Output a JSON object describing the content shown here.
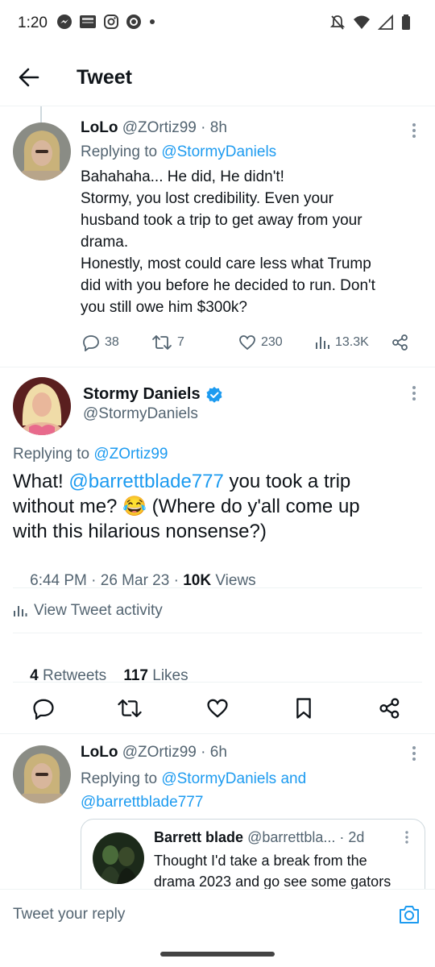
{
  "status_bar": {
    "time": "1:20"
  },
  "header": {
    "title": "Tweet"
  },
  "tweet1": {
    "name": "LoLo",
    "handle": "@ZOrtiz99",
    "time": "· 8h",
    "replying_prefix": "Replying to",
    "replying_to": "@StormyDaniels",
    "lines": [
      "Bahahaha... He did, He didn't!",
      "Stormy, you lost credibility. Even your",
      "husband took a trip to get away from your",
      "drama.",
      "Honestly, most could care less what Trump",
      "did with you before he decided to run. Don't",
      "you still owe him $300k?"
    ],
    "replies": "38",
    "retweets": "7",
    "likes": "230",
    "views": "13.3K"
  },
  "main_tweet": {
    "name": "Stormy Daniels",
    "handle": "@StormyDaniels",
    "replying_prefix": "Replying to",
    "replying_to": "@ZOrtiz99",
    "text_start": "What! ",
    "mention": "@barrettblade777",
    "text_line1_end": " you took a trip",
    "text_line2": "without me? 😂 (Where do y'all come up",
    "text_line3": "with this hilarious nonsense?)",
    "timestamp": "6:44 PM · 26 Mar 23 · ",
    "views_count": "10K",
    "views_label": " Views",
    "activity_label": "View Tweet activity",
    "retweets_count": "4",
    "retweets_label": " Retweets",
    "likes_count": "117",
    "likes_label": " Likes"
  },
  "tweet3": {
    "name": "LoLo",
    "handle": "@ZOrtiz99",
    "time": "· 6h",
    "replying_prefix": "Replying to",
    "replying_to_1": "@StormyDaniels",
    "and_label": " and",
    "replying_to_2": "@barrettblade777",
    "quoted": {
      "name": "Barrett blade",
      "handle": "@barrettbla...",
      "time": "· 2d",
      "line1": "Thought I'd take a break from the",
      "line2": "drama 2023 and go see some gators"
    }
  },
  "reply_bar": {
    "placeholder": "Tweet your reply"
  },
  "colors": {
    "accent": "#1d9bf0",
    "text": "#0f1419",
    "muted": "#536471"
  }
}
